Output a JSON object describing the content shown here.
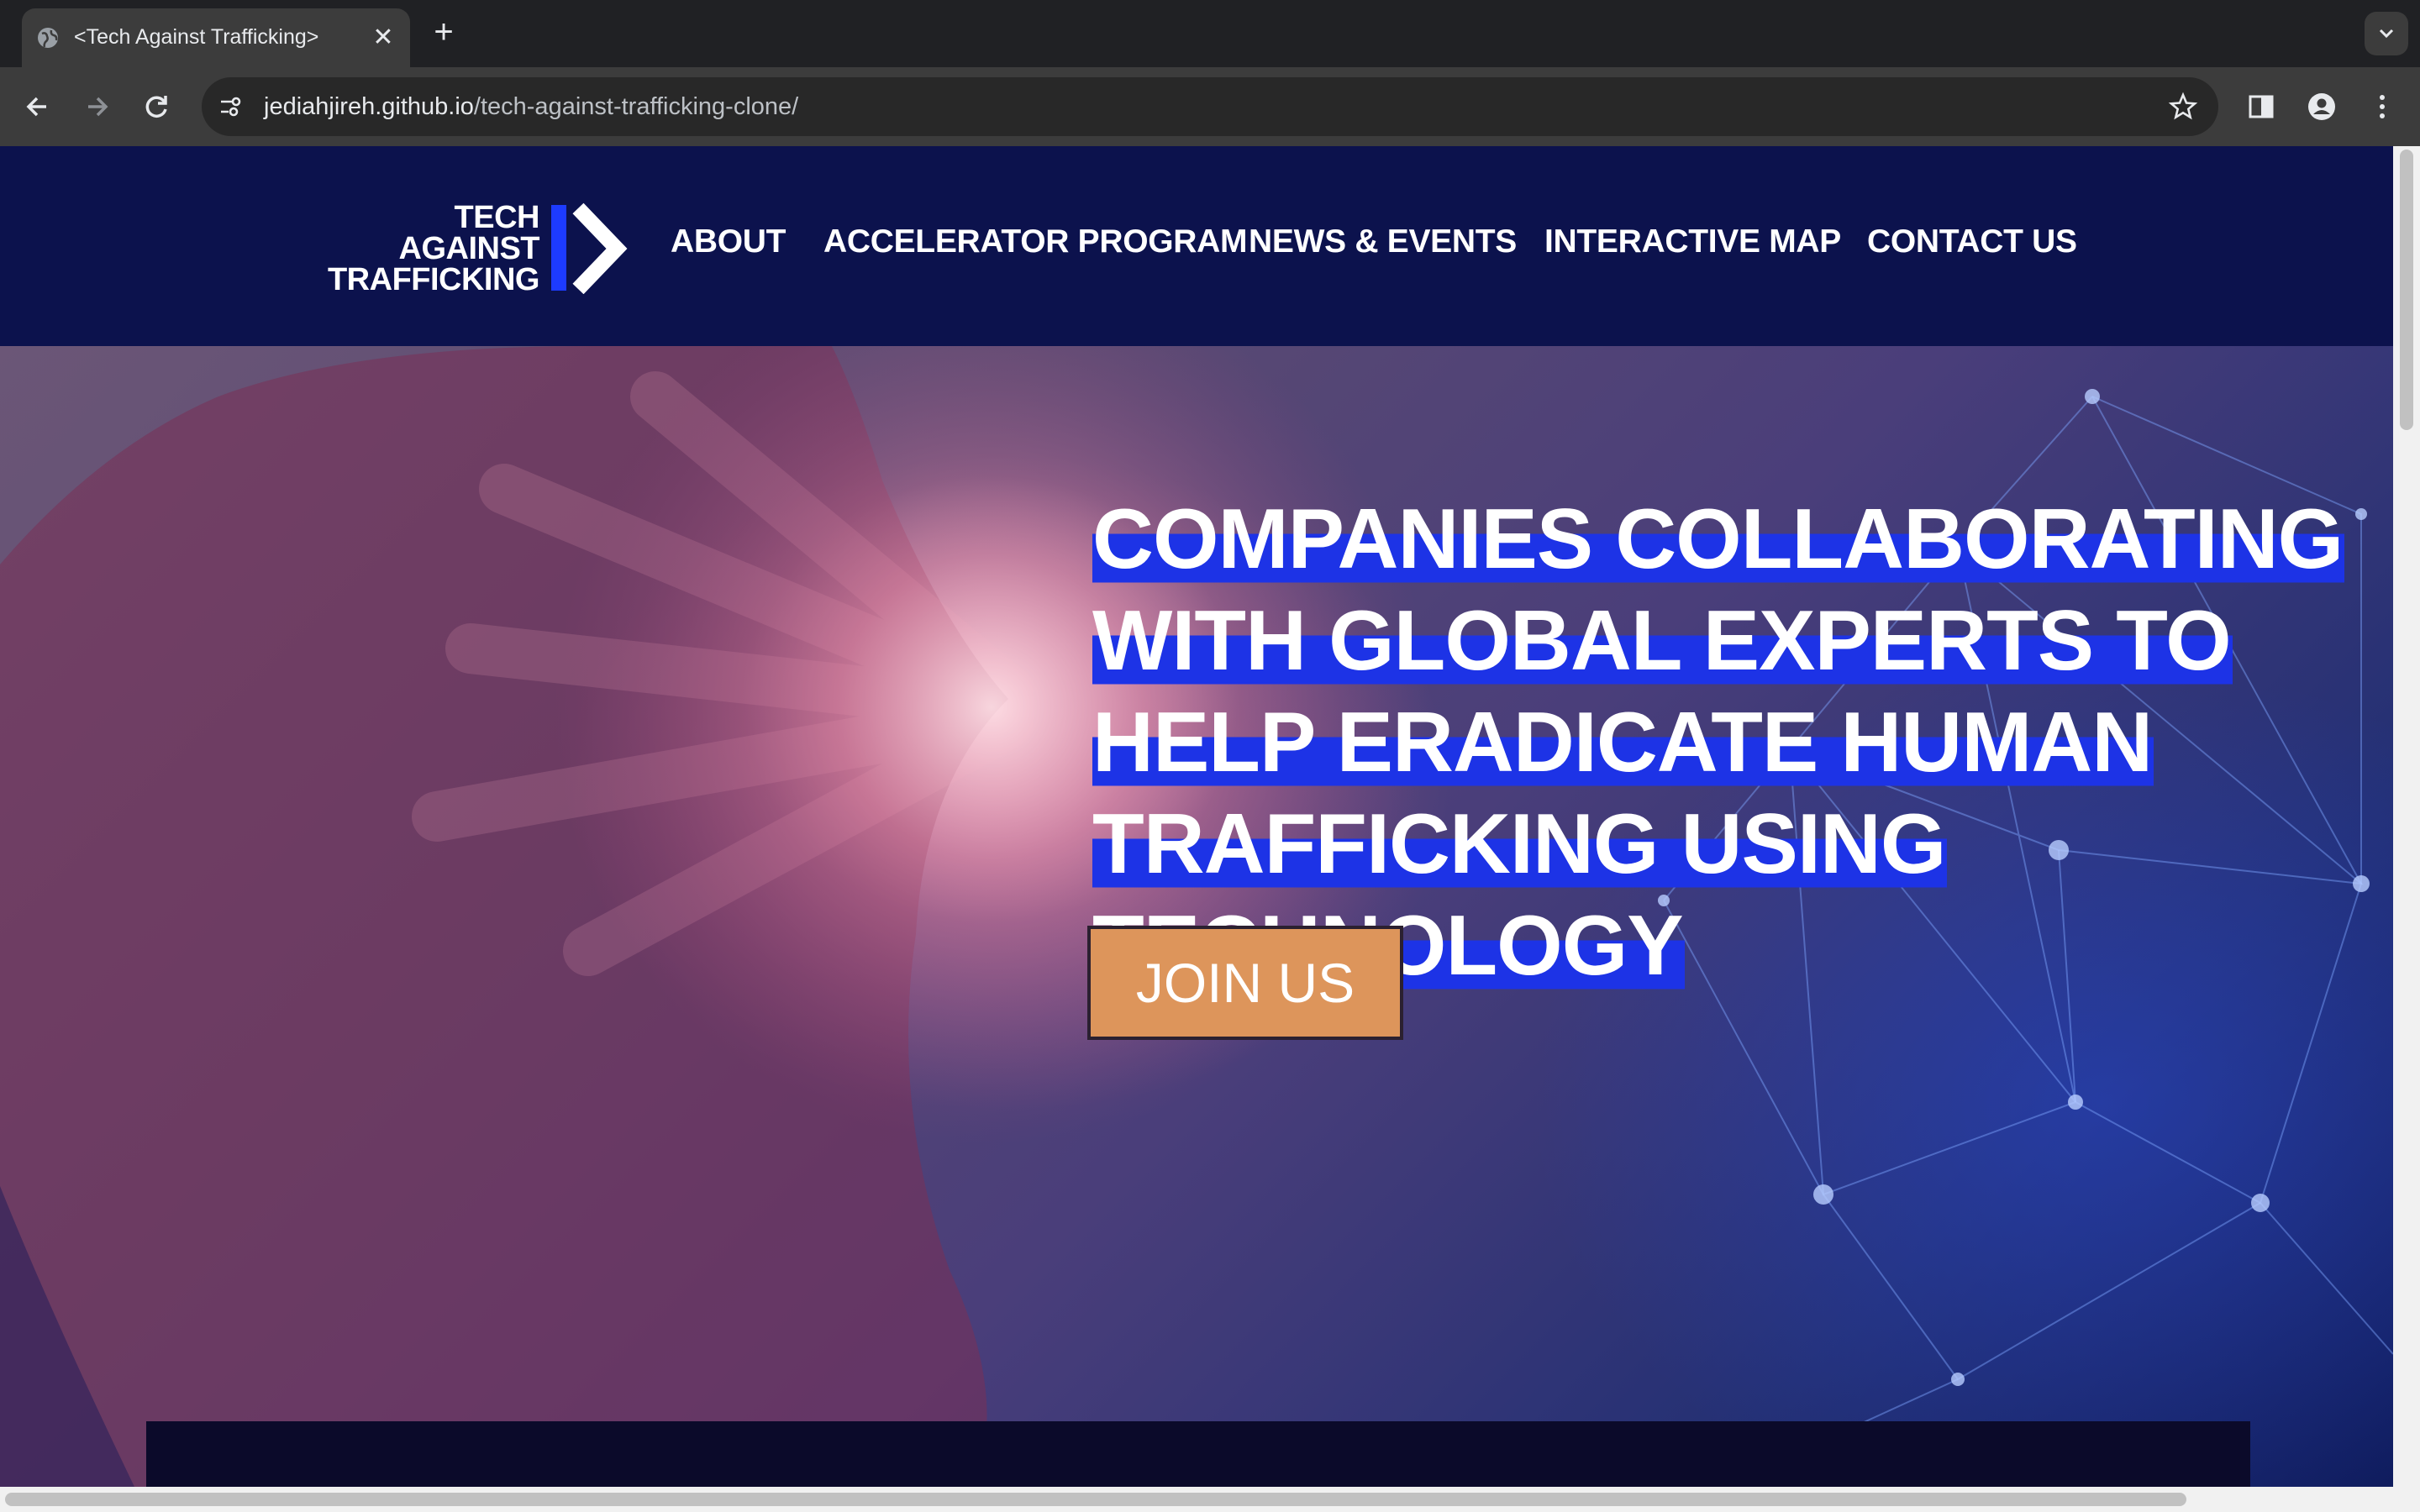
{
  "browser": {
    "tab_title": "<Tech Against Trafficking>",
    "url_host": "jediahjireh.github.io",
    "url_path": "/tech-against-trafficking-clone/"
  },
  "logo": {
    "lines": [
      "TECH",
      "AGAINST",
      "TRAFFICKING"
    ],
    "accent_color": "#1d3bff"
  },
  "nav": {
    "items": [
      "ABOUT",
      "ACCELERATOR PROGRAM",
      "NEWS & EVENTS",
      "INTERACTIVE MAP",
      "CONTACT US"
    ]
  },
  "hero": {
    "headline_lines": [
      "COMPANIES COLLABORATING",
      "WITH GLOBAL EXPERTS TO",
      "HELP ERADICATE HUMAN",
      "TRAFFICKING USING",
      "TECHNOLOGY"
    ],
    "cta_label": "JOIN US",
    "highlight_color": "#1d33e6",
    "cta_color": "#dd955b"
  },
  "colors": {
    "header_bg": "#0c124d"
  }
}
